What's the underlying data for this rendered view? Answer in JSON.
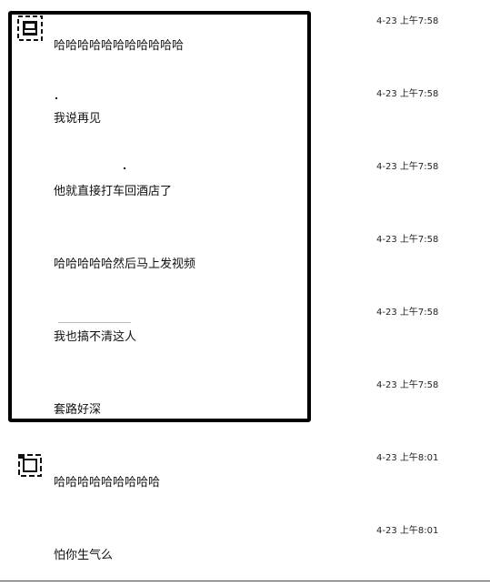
{
  "messages": [
    {
      "text": "哈哈哈哈哈哈哈哈哈哈哈",
      "time": "4-23 上午7:58"
    },
    {
      "text": "我说再见",
      "time": "4-23 上午7:58"
    },
    {
      "text": "他就直接打车回酒店了",
      "time": "4-23 上午7:58"
    },
    {
      "text": "哈哈哈哈哈然后马上发视频",
      "time": "4-23 上午7:58"
    },
    {
      "text": "我也搞不清这人",
      "time": "4-23 上午7:58"
    },
    {
      "text": "套路好深",
      "time": "4-23 上午7:58"
    },
    {
      "text": "哈哈哈哈哈哈哈哈哈",
      "time": "4-23 上午8:01"
    },
    {
      "text": "怕你生气么",
      "time": "4-23 上午8:01"
    }
  ],
  "avatars": [
    {
      "icon": "avatar-icon"
    },
    {
      "icon": "avatar-icon"
    }
  ],
  "colors": {
    "background": "#ffffff",
    "text": "#111111",
    "highlight_border": "#000000"
  }
}
